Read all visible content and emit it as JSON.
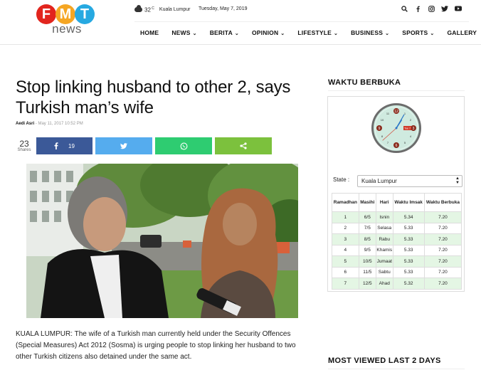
{
  "logo": {
    "letters": [
      "F",
      "M",
      "T"
    ],
    "sub": "news",
    "colors": [
      "#e2251e",
      "#f5a623",
      "#27a9e1"
    ]
  },
  "topbar": {
    "temp": "32",
    "temp_unit": "C",
    "city": "Kuala Lumpur",
    "date": "Tuesday, May 7, 2019",
    "social_icons": [
      "search-icon",
      "facebook-icon",
      "instagram-icon",
      "twitter-icon",
      "youtube-icon"
    ]
  },
  "nav": {
    "items": [
      {
        "label": "HOME",
        "dropdown": false
      },
      {
        "label": "NEWS",
        "dropdown": true
      },
      {
        "label": "BERITA",
        "dropdown": true
      },
      {
        "label": "OPINION",
        "dropdown": true
      },
      {
        "label": "LIFESTYLE",
        "dropdown": true
      },
      {
        "label": "BUSINESS",
        "dropdown": true
      },
      {
        "label": "SPORTS",
        "dropdown": true
      },
      {
        "label": "GALLERY",
        "dropdown": false
      }
    ]
  },
  "article": {
    "title": "Stop linking husband to other 2, says Turkish man’s wife",
    "author": "Aedi Asri",
    "separator": "-",
    "timestamp": "May 11, 2017 10:52 PM",
    "shares_count": "23",
    "shares_label": "Shares",
    "fb_count": "19",
    "body": "KUALA LUMPUR: The wife of a Turkish man currently held under the Security Offences (Special Measures) Act 2012 (Sosma) is urging people to stop linking her husband to two other Turkish citizens also detained under the same act."
  },
  "sidebar": {
    "waktu_title": "WAKTU BERBUKA",
    "clock": {
      "hour": 1,
      "minute": 5,
      "second": 38,
      "date_label": "Tue 7"
    },
    "state_label": "State :",
    "state_value": "Kuala Lumpur",
    "table": {
      "headers": [
        "Ramadhan",
        "Masihi",
        "Hari",
        "Waktu Imsak",
        "Waktu Berbuka"
      ],
      "rows": [
        [
          "1",
          "6/5",
          "Isnin",
          "5.34",
          "7.20"
        ],
        [
          "2",
          "7/5",
          "Selasa",
          "5.33",
          "7.20"
        ],
        [
          "3",
          "8/5",
          "Rabu",
          "5.33",
          "7.20"
        ],
        [
          "4",
          "9/5",
          "Khamis",
          "5.33",
          "7.20"
        ],
        [
          "5",
          "10/5",
          "Jumaat",
          "5.33",
          "7.20"
        ],
        [
          "6",
          "11/5",
          "Sabtu",
          "5.33",
          "7.20"
        ],
        [
          "7",
          "12/5",
          "Ahad",
          "5.32",
          "7.20"
        ]
      ]
    },
    "most_viewed_title": "MOST VIEWED LAST 2 DAYS"
  }
}
